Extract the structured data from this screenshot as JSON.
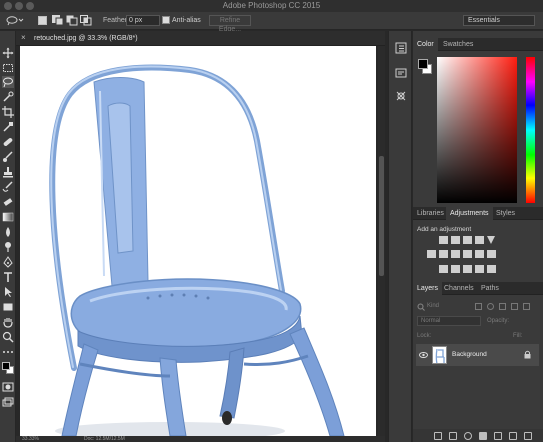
{
  "app": {
    "title": "Adobe Photoshop CC 2015"
  },
  "options_bar": {
    "feather_label": "Feather:",
    "feather_value": "0 px",
    "antialias_label": "Anti-alias",
    "refine_button": "Refine Edge...",
    "workspace": "Essentials"
  },
  "document": {
    "tab_title": "retouched.jpg @ 33.3% (RGB/8*)",
    "close_label": "×",
    "zoom": "33.33%",
    "doc_info": "Doc: 12.5M/12.5M"
  },
  "color_panel": {
    "tabs": [
      "Color",
      "Swatches"
    ],
    "foreground_color": "#000000",
    "background_color": "#ffffff"
  },
  "adjustments_panel": {
    "tabs": [
      "Libraries",
      "Adjustments",
      "Styles"
    ],
    "heading": "Add an adjustment"
  },
  "layers_panel": {
    "tabs": [
      "Layers",
      "Channels",
      "Paths"
    ],
    "filter_placeholder": "Kind",
    "blend_mode": "Normal",
    "opacity_label": "Opacity:",
    "lock_label": "Lock:",
    "fill_label": "Fill:",
    "layers": [
      {
        "name": "Background",
        "visible": true,
        "locked": true
      }
    ]
  },
  "colors": {
    "chair": "#8aaee0",
    "ui_dark": "#282828",
    "ui_panel": "#3a3a3a"
  }
}
